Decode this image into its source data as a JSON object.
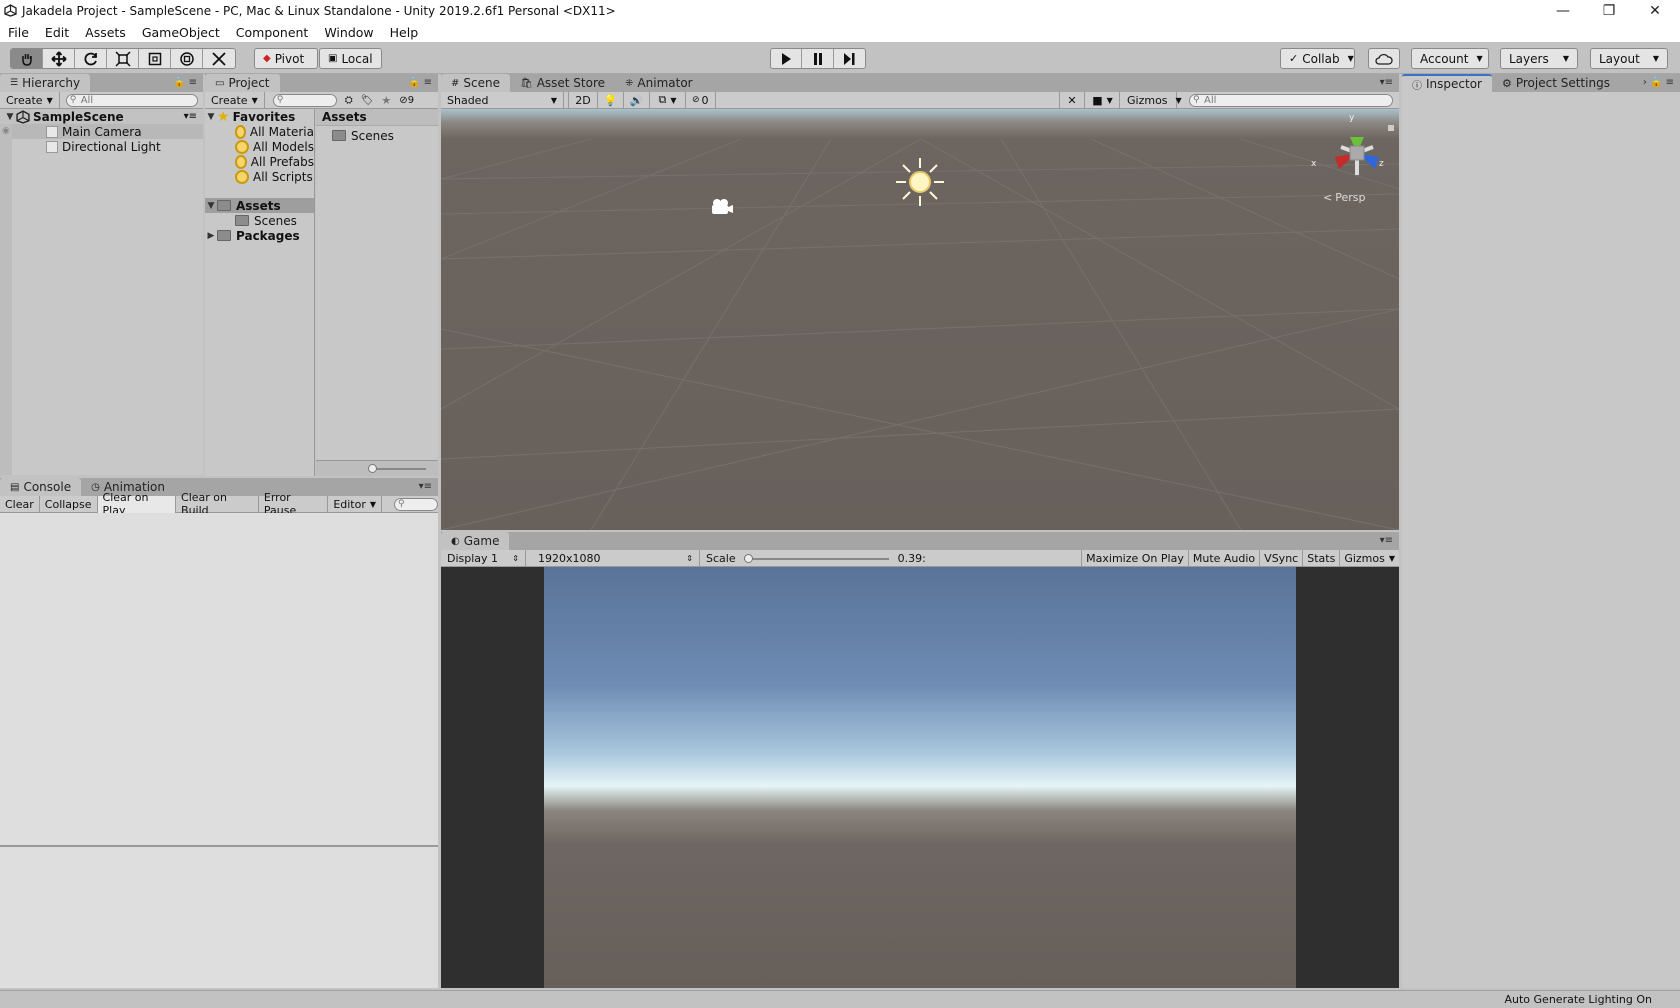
{
  "window": {
    "title": "Jakadela Project - SampleScene - PC, Mac & Linux Standalone - Unity 2019.2.6f1 Personal <DX11>",
    "minimize": "—",
    "restore": "❐",
    "close": "✕"
  },
  "menu": [
    "File",
    "Edit",
    "Assets",
    "GameObject",
    "Component",
    "Window",
    "Help"
  ],
  "toolbar": {
    "tools": [
      "hand-tool-icon",
      "move-tool-icon",
      "rotate-tool-icon",
      "scale-tool-icon",
      "rect-tool-icon",
      "transform-tool-icon",
      "custom-tool-icon"
    ],
    "pivot": "Pivot",
    "local": "Local",
    "collab": "Collab",
    "account": "Account",
    "layers": "Layers",
    "layout": "Layout"
  },
  "hierarchy": {
    "tab": "Hierarchy",
    "create": "Create",
    "search_placeholder": "All",
    "scene": "SampleScene",
    "items": [
      "Main Camera",
      "Directional Light"
    ]
  },
  "project": {
    "tab": "Project",
    "create": "Create",
    "hidden_count": "9",
    "favorites_label": "Favorites",
    "favorites": [
      "All Materia",
      "All Models",
      "All Prefabs",
      "All Scripts"
    ],
    "assets_label": "Assets",
    "assets_children": [
      "Scenes"
    ],
    "packages_label": "Packages",
    "main_header": "Assets",
    "main_items": [
      "Scenes"
    ]
  },
  "scene": {
    "tabs": [
      "Scene",
      "Asset Store",
      "Animator"
    ],
    "shading": "Shaded",
    "mode2d": "2D",
    "fx_count": "0",
    "gizmos": "Gizmos",
    "search_placeholder": "All",
    "persp": "Persp",
    "axis_x": "x",
    "axis_y": "y",
    "axis_z": "z"
  },
  "console": {
    "tabs": [
      "Console",
      "Animation"
    ],
    "buttons": [
      "Clear",
      "Collapse",
      "Clear on Play",
      "Clear on Build",
      "Error Pause"
    ],
    "editor": "Editor"
  },
  "game": {
    "tab": "Game",
    "display": "Display 1",
    "resolution": "1920x1080",
    "scale_label": "Scale",
    "scale_value": "0.39:",
    "buttons": [
      "Maximize On Play",
      "Mute Audio",
      "VSync",
      "Stats",
      "Gizmos"
    ]
  },
  "inspector": {
    "tabs": [
      "Inspector",
      "Project Settings"
    ]
  },
  "status": {
    "text": "Auto Generate Lighting On"
  }
}
